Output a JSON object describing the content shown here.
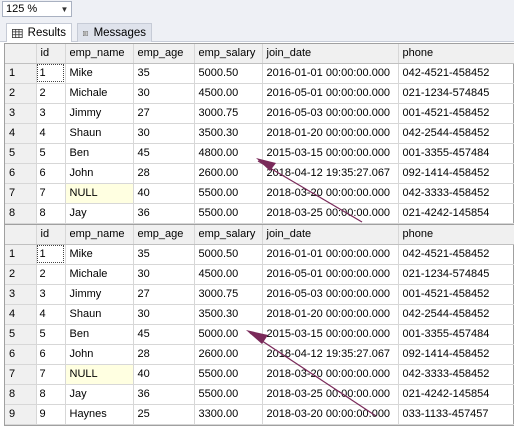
{
  "zoom": {
    "value": "125 %"
  },
  "tabs": [
    {
      "label": "Results",
      "icon": "grid-icon"
    },
    {
      "label": "Messages",
      "icon": "messages-icon"
    }
  ],
  "columns": [
    "id",
    "emp_name",
    "emp_age",
    "emp_salary",
    "join_date",
    "phone"
  ],
  "grid1": {
    "rows": [
      {
        "rn": "1",
        "id": "1",
        "emp_name": "Mike",
        "emp_age": "35",
        "emp_salary": "5000.50",
        "join_date": "2016-01-01 00:00:00.000",
        "phone": "042-4521-458452"
      },
      {
        "rn": "2",
        "id": "2",
        "emp_name": "Michale",
        "emp_age": "30",
        "emp_salary": "4500.00",
        "join_date": "2016-05-01 00:00:00.000",
        "phone": "021-1234-574845"
      },
      {
        "rn": "3",
        "id": "3",
        "emp_name": "Jimmy",
        "emp_age": "27",
        "emp_salary": "3000.75",
        "join_date": "2016-05-03 00:00:00.000",
        "phone": "001-4521-458452"
      },
      {
        "rn": "4",
        "id": "4",
        "emp_name": "Shaun",
        "emp_age": "30",
        "emp_salary": "3500.30",
        "join_date": "2018-01-20 00:00:00.000",
        "phone": "042-2544-458452"
      },
      {
        "rn": "5",
        "id": "5",
        "emp_name": "Ben",
        "emp_age": "45",
        "emp_salary": "4800.00",
        "join_date": "2015-03-15 00:00:00.000",
        "phone": "001-3355-457484"
      },
      {
        "rn": "6",
        "id": "6",
        "emp_name": "John",
        "emp_age": "28",
        "emp_salary": "2600.00",
        "join_date": "2018-04-12 19:35:27.067",
        "phone": "092-1414-458452"
      },
      {
        "rn": "7",
        "id": "7",
        "emp_name": "NULL",
        "emp_age": "40",
        "emp_salary": "5500.00",
        "join_date": "2018-03-20 00:00:00.000",
        "phone": "042-3333-458452"
      },
      {
        "rn": "8",
        "id": "8",
        "emp_name": "Jay",
        "emp_age": "36",
        "emp_salary": "5500.00",
        "join_date": "2018-03-25 00:00:00.000",
        "phone": "021-4242-145854"
      }
    ]
  },
  "grid2": {
    "rows": [
      {
        "rn": "1",
        "id": "1",
        "emp_name": "Mike",
        "emp_age": "35",
        "emp_salary": "5000.50",
        "join_date": "2016-01-01 00:00:00.000",
        "phone": "042-4521-458452"
      },
      {
        "rn": "2",
        "id": "2",
        "emp_name": "Michale",
        "emp_age": "30",
        "emp_salary": "4500.00",
        "join_date": "2016-05-01 00:00:00.000",
        "phone": "021-1234-574845"
      },
      {
        "rn": "3",
        "id": "3",
        "emp_name": "Jimmy",
        "emp_age": "27",
        "emp_salary": "3000.75",
        "join_date": "2016-05-03 00:00:00.000",
        "phone": "001-4521-458452"
      },
      {
        "rn": "4",
        "id": "4",
        "emp_name": "Shaun",
        "emp_age": "30",
        "emp_salary": "3500.30",
        "join_date": "2018-01-20 00:00:00.000",
        "phone": "042-2544-458452"
      },
      {
        "rn": "5",
        "id": "5",
        "emp_name": "Ben",
        "emp_age": "45",
        "emp_salary": "5000.00",
        "join_date": "2015-03-15 00:00:00.000",
        "phone": "001-3355-457484"
      },
      {
        "rn": "6",
        "id": "6",
        "emp_name": "John",
        "emp_age": "28",
        "emp_salary": "2600.00",
        "join_date": "2018-04-12 19:35:27.067",
        "phone": "092-1414-458452"
      },
      {
        "rn": "7",
        "id": "7",
        "emp_name": "NULL",
        "emp_age": "40",
        "emp_salary": "5500.00",
        "join_date": "2018-03-20 00:00:00.000",
        "phone": "042-3333-458452"
      },
      {
        "rn": "8",
        "id": "8",
        "emp_name": "Jay",
        "emp_age": "36",
        "emp_salary": "5500.00",
        "join_date": "2018-03-25 00:00:00.000",
        "phone": "021-4242-145854"
      },
      {
        "rn": "9",
        "id": "9",
        "emp_name": "Haynes",
        "emp_age": "25",
        "emp_salary": "3300.00",
        "join_date": "2018-03-20 00:00:00.000",
        "phone": "033-1133-457457"
      }
    ]
  },
  "colors": {
    "null_cell": "#ffffe1",
    "arrow": "#7a2a5a",
    "header_bg": "#f0f0f0"
  }
}
